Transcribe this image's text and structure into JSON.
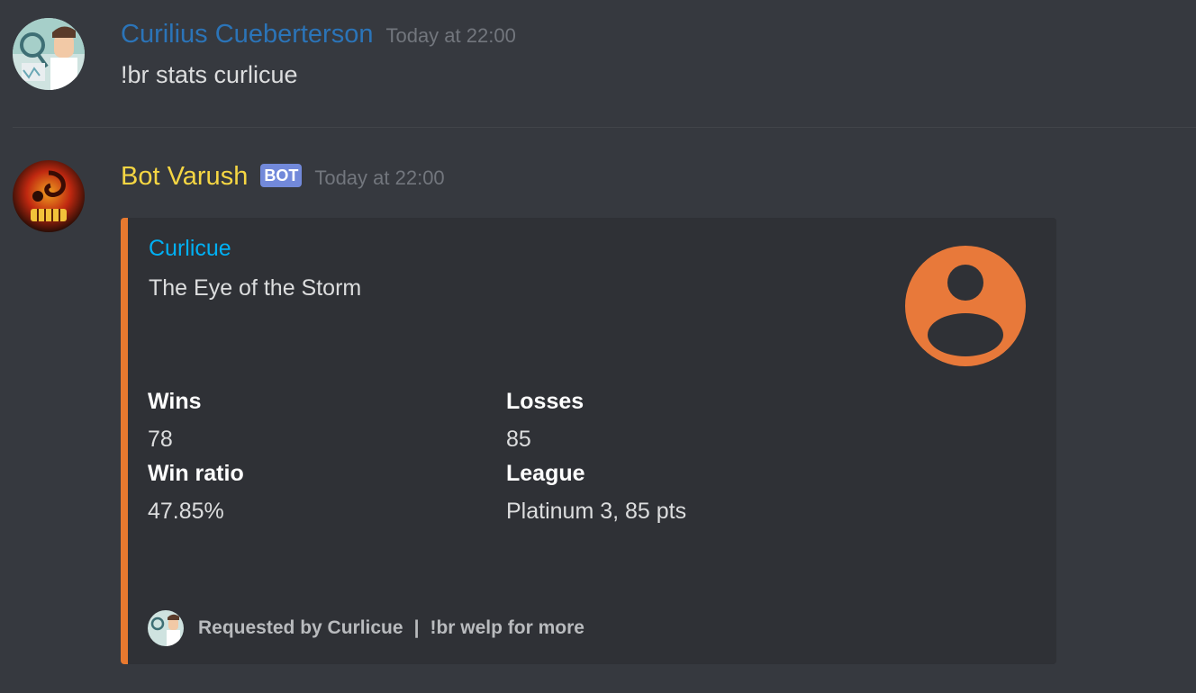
{
  "messages": [
    {
      "author": "Curilius Cueberterson",
      "author_color": "#2b74b8",
      "timestamp": "Today at 22:00",
      "content": "!br stats curlicue",
      "avatar_icon": "scientist-avatar-icon"
    },
    {
      "author": "Bot Varush",
      "author_color": "#f5d643",
      "bot_tag": "BOT",
      "timestamp": "Today at 22:00",
      "avatar_icon": "fiery-skull-avatar-icon",
      "embed": {
        "accent_color": "#e8792f",
        "title": "Curlicue",
        "description": "The Eye of the Storm",
        "thumbnail_icon": "default-user-icon",
        "fields": [
          {
            "name": "Wins",
            "value": "78"
          },
          {
            "name": "Losses",
            "value": "85"
          },
          {
            "name": "Win ratio",
            "value": "47.85%"
          },
          {
            "name": "League",
            "value": "Platinum 3, 85 pts"
          }
        ],
        "footer": {
          "icon": "scientist-avatar-icon",
          "text": "Requested by Curlicue",
          "separator": "|",
          "hint": "!br welp for more"
        }
      }
    }
  ]
}
